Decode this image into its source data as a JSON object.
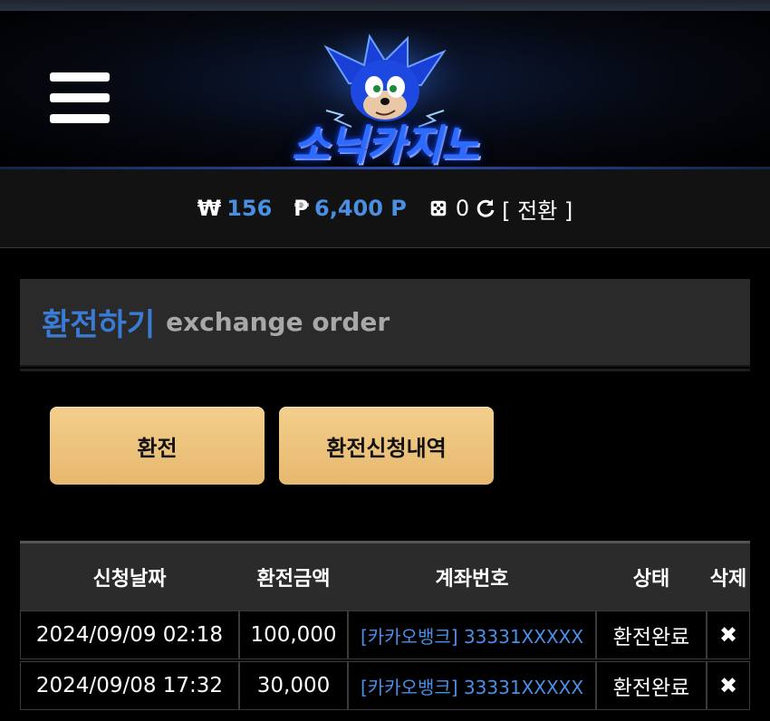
{
  "header": {
    "logo_text": "소닉카지노"
  },
  "balance": {
    "won_symbol": "₩",
    "won_amount": "156",
    "point_symbol": "₱",
    "point_amount": "6,400 P",
    "game_count": "0",
    "convert_label": "[ 전환 ]"
  },
  "panel": {
    "title_ko": "환전하기",
    "title_en": "exchange order"
  },
  "buttons": {
    "exchange": "환전",
    "history": "환전신청내역"
  },
  "table": {
    "headers": [
      "신청날짜",
      "환전금액",
      "계좌번호",
      "상태",
      "삭제"
    ],
    "rows": [
      {
        "date": "2024/09/09 02:18",
        "amount": "100,000",
        "account": "[카카오뱅크] 33331XXXXX",
        "status": "환전완료",
        "delete": "✖"
      },
      {
        "date": "2024/09/08 17:32",
        "amount": "30,000",
        "account": "[카카오뱅크] 33331XXXXX",
        "status": "환전완료",
        "delete": "✖"
      }
    ]
  },
  "colors": {
    "accent_blue": "#4a90e2",
    "button_gold": "#eebf74",
    "panel_bg": "#2a2a2a"
  }
}
